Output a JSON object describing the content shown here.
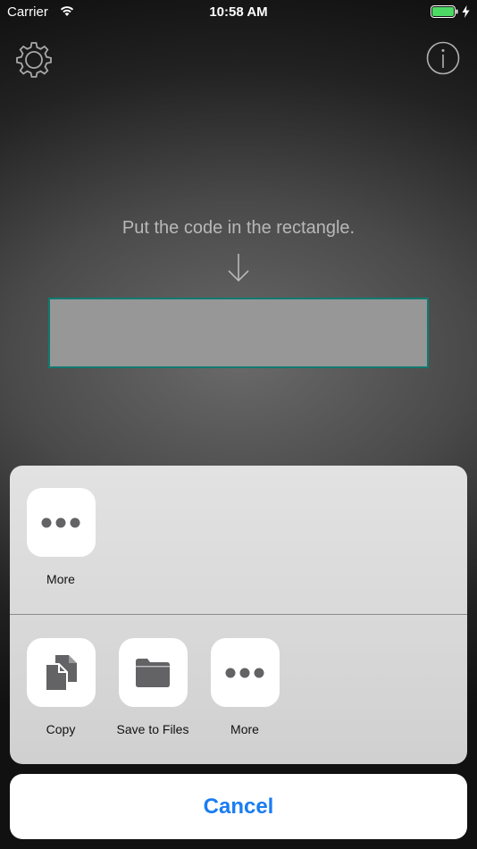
{
  "status_bar": {
    "carrier": "Carrier",
    "time": "10:58 AM",
    "battery_color": "#4cd964"
  },
  "scanner": {
    "hint": "Put the code in the rectangle.",
    "frame_color": "#127a70"
  },
  "share_sheet": {
    "top_row": [
      {
        "label": "More",
        "icon": "ellipsis-icon"
      }
    ],
    "bottom_row": [
      {
        "label": "Copy",
        "icon": "copy-icon"
      },
      {
        "label": "Save to Files",
        "icon": "folder-icon"
      },
      {
        "label": "More",
        "icon": "ellipsis-icon"
      }
    ],
    "cancel_label": "Cancel",
    "accent_color": "#1a7cf3"
  }
}
